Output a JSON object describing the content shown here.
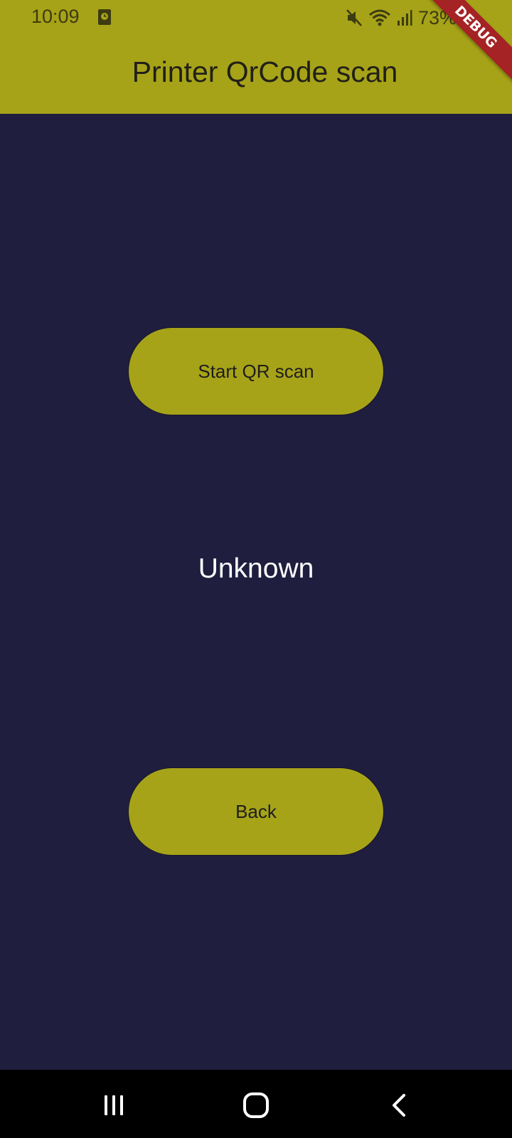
{
  "status_bar": {
    "time": "10:09",
    "battery_text": "73%",
    "icons": [
      "app-notification-icon",
      "mute-icon",
      "wifi-icon",
      "signal-icon",
      "battery-icon"
    ]
  },
  "app_bar": {
    "title": "Printer QrCode scan",
    "debug_banner": "DEBUG",
    "color": "#a6a319"
  },
  "main": {
    "background": "#201e3f",
    "start_button_label": "Start QR scan",
    "result_text": "Unknown",
    "back_button_label": "Back"
  },
  "nav_bar": {
    "icons": [
      "recents-icon",
      "home-icon",
      "back-icon"
    ]
  }
}
